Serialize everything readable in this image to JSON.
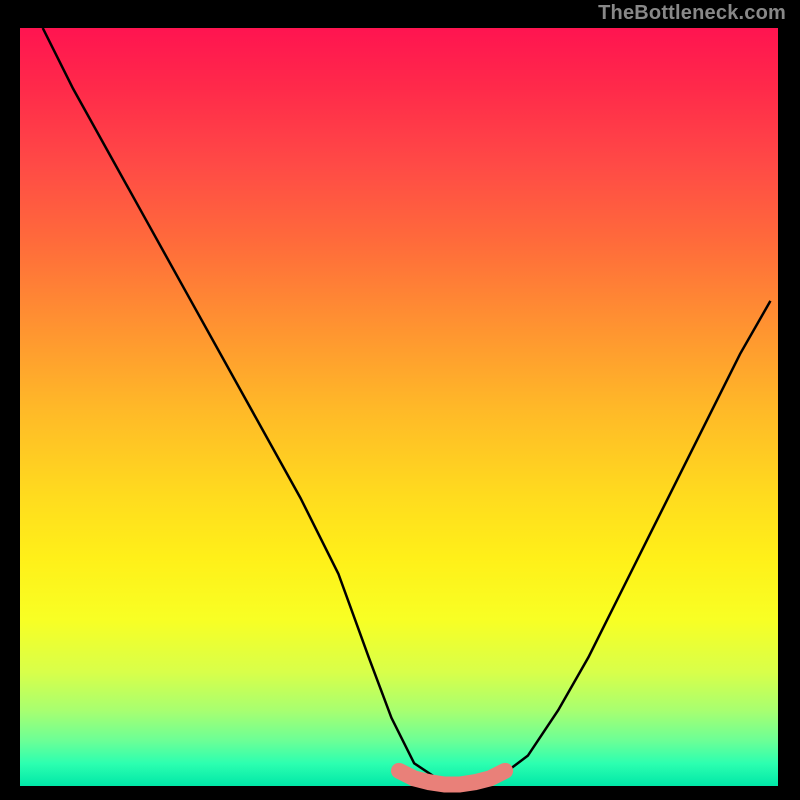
{
  "watermark": "TheBottleneck.com",
  "chart_data": {
    "type": "line",
    "title": "",
    "xlabel": "",
    "ylabel": "",
    "xlim": [
      0,
      100
    ],
    "ylim": [
      0,
      100
    ],
    "grid": false,
    "series": [
      {
        "name": "bottleneck-curve",
        "x": [
          3,
          7,
          12,
          17,
          22,
          27,
          32,
          37,
          42,
          46,
          49,
          52,
          55,
          58,
          61,
          63,
          67,
          71,
          75,
          79,
          83,
          87,
          91,
          95,
          99
        ],
        "values": [
          100,
          92,
          83,
          74,
          65,
          56,
          47,
          38,
          28,
          17,
          9,
          3,
          1,
          0,
          0,
          1,
          4,
          10,
          17,
          25,
          33,
          41,
          49,
          57,
          64
        ]
      },
      {
        "name": "flat-bottom-highlight",
        "x": [
          50,
          52,
          54,
          56,
          58,
          60,
          62,
          64
        ],
        "values": [
          2,
          1,
          0.5,
          0.2,
          0.2,
          0.5,
          1,
          2
        ]
      }
    ],
    "colors": {
      "curve": "#000000",
      "highlight": "#e98079",
      "gradient_top": "#ff1450",
      "gradient_bottom": "#00e8a8"
    }
  }
}
